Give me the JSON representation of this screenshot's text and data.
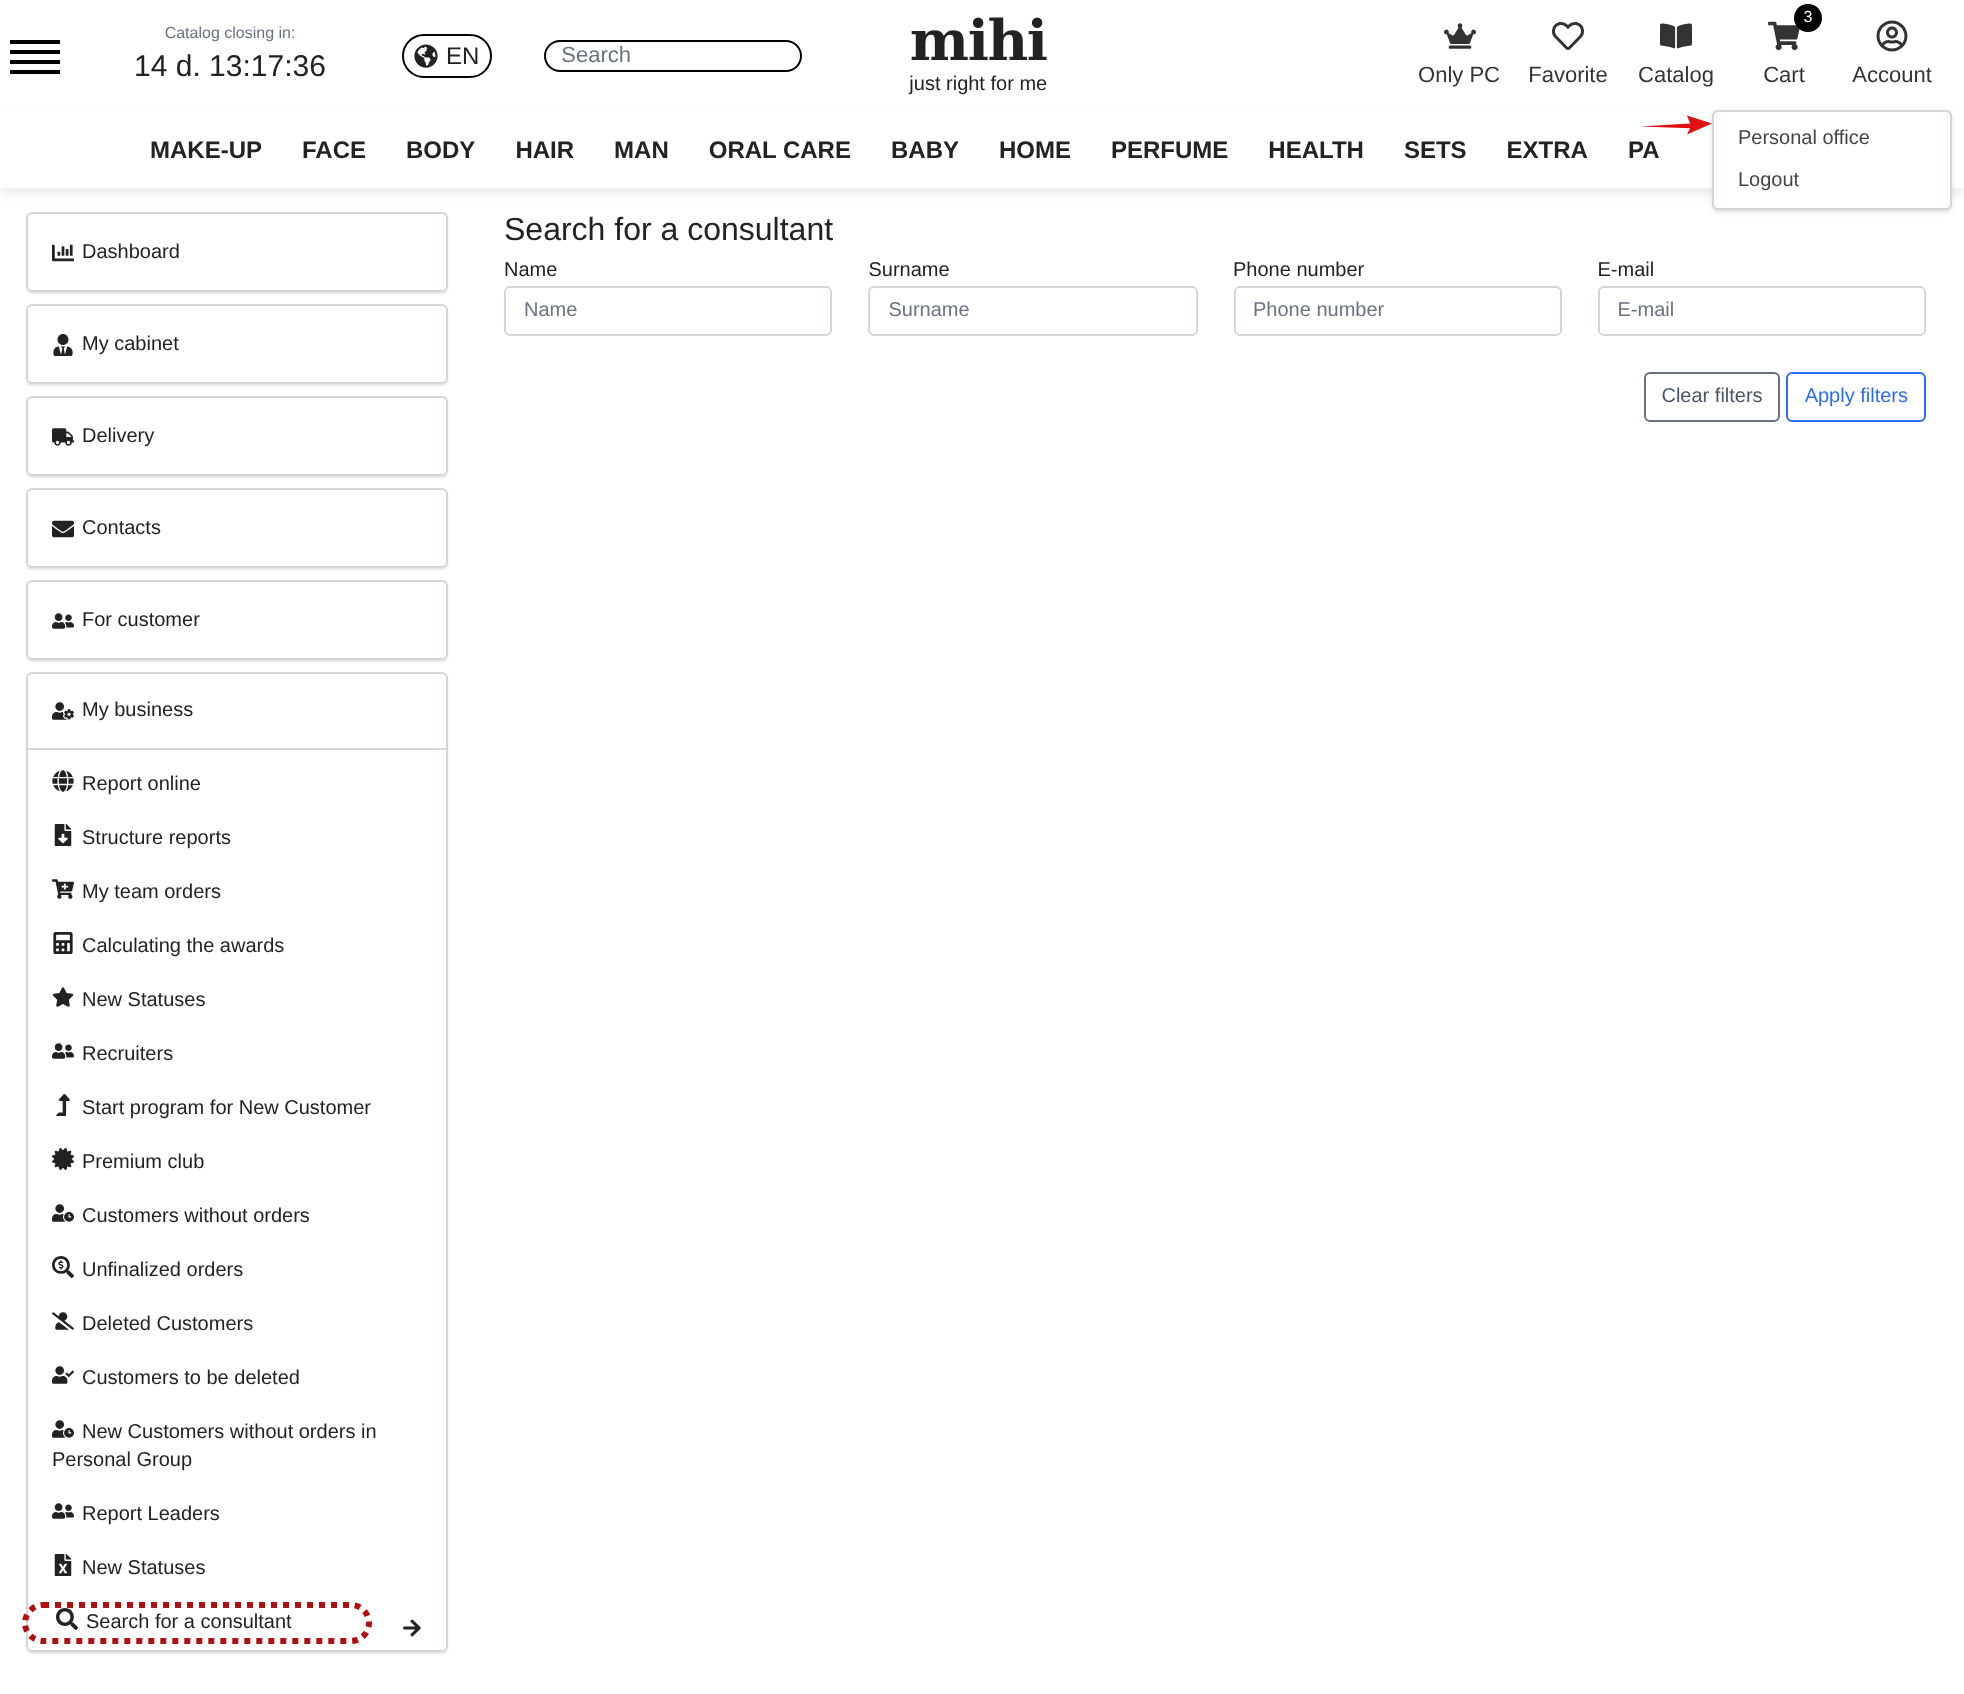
{
  "header": {
    "countdown_label": "Catalog closing in:",
    "countdown": "14 d. 13:17:36",
    "language": "EN",
    "search": {
      "placeholder": "Search"
    },
    "logo": "mihi",
    "tagline": "just right for me",
    "actions": [
      {
        "label": "Only PC"
      },
      {
        "label": "Favorite"
      },
      {
        "label": "Catalog"
      },
      {
        "label": "Cart",
        "badge": "3"
      },
      {
        "label": "Account"
      }
    ]
  },
  "nav": [
    "MAKE-UP",
    "FACE",
    "BODY",
    "HAIR",
    "MAN",
    "ORAL CARE",
    "BABY",
    "HOME",
    "PERFUME",
    "HEALTH",
    "SETS",
    "EXTRA",
    "PA"
  ],
  "account_menu": [
    "Personal office",
    "Logout"
  ],
  "sidebar": {
    "items": [
      {
        "label": "Dashboard"
      },
      {
        "label": "My cabinet"
      },
      {
        "label": "Delivery"
      },
      {
        "label": "Contacts"
      },
      {
        "label": "For customer"
      },
      {
        "label": "My business",
        "expanded": true,
        "children": [
          {
            "label": "Report online",
            "selected": false
          },
          {
            "label": "Structure reports",
            "selected": false
          },
          {
            "label": "My team orders",
            "selected": false
          },
          {
            "label": "Calculating the awards",
            "selected": false
          },
          {
            "label": "New Statuses",
            "selected": false
          },
          {
            "label": "Recruiters",
            "selected": false
          },
          {
            "label": "Start program for New Customer",
            "selected": false
          },
          {
            "label": "Premium club",
            "selected": false
          },
          {
            "label": "Customers without orders",
            "selected": false
          },
          {
            "label": "Unfinalized orders",
            "selected": false
          },
          {
            "label": "Deleted Customers",
            "selected": false
          },
          {
            "label": "Customers to be deleted",
            "selected": false
          },
          {
            "label": "New Customers without orders in Personal Group",
            "selected": false
          },
          {
            "label": "Report Leaders",
            "selected": false
          },
          {
            "label": "New Statuses",
            "selected": false
          },
          {
            "label": "Search for a consultant",
            "selected": true
          }
        ]
      }
    ]
  },
  "main": {
    "title": "Search for a consultant",
    "fields": [
      {
        "label": "Name",
        "placeholder": "Name"
      },
      {
        "label": "Surname",
        "placeholder": "Surname"
      },
      {
        "label": "Phone number",
        "placeholder": "Phone number"
      },
      {
        "label": "E-mail",
        "placeholder": "E-mail"
      }
    ],
    "buttons": [
      {
        "label": "Clear filters",
        "kind": "secondary"
      },
      {
        "label": "Apply filters",
        "kind": "primary"
      }
    ]
  }
}
